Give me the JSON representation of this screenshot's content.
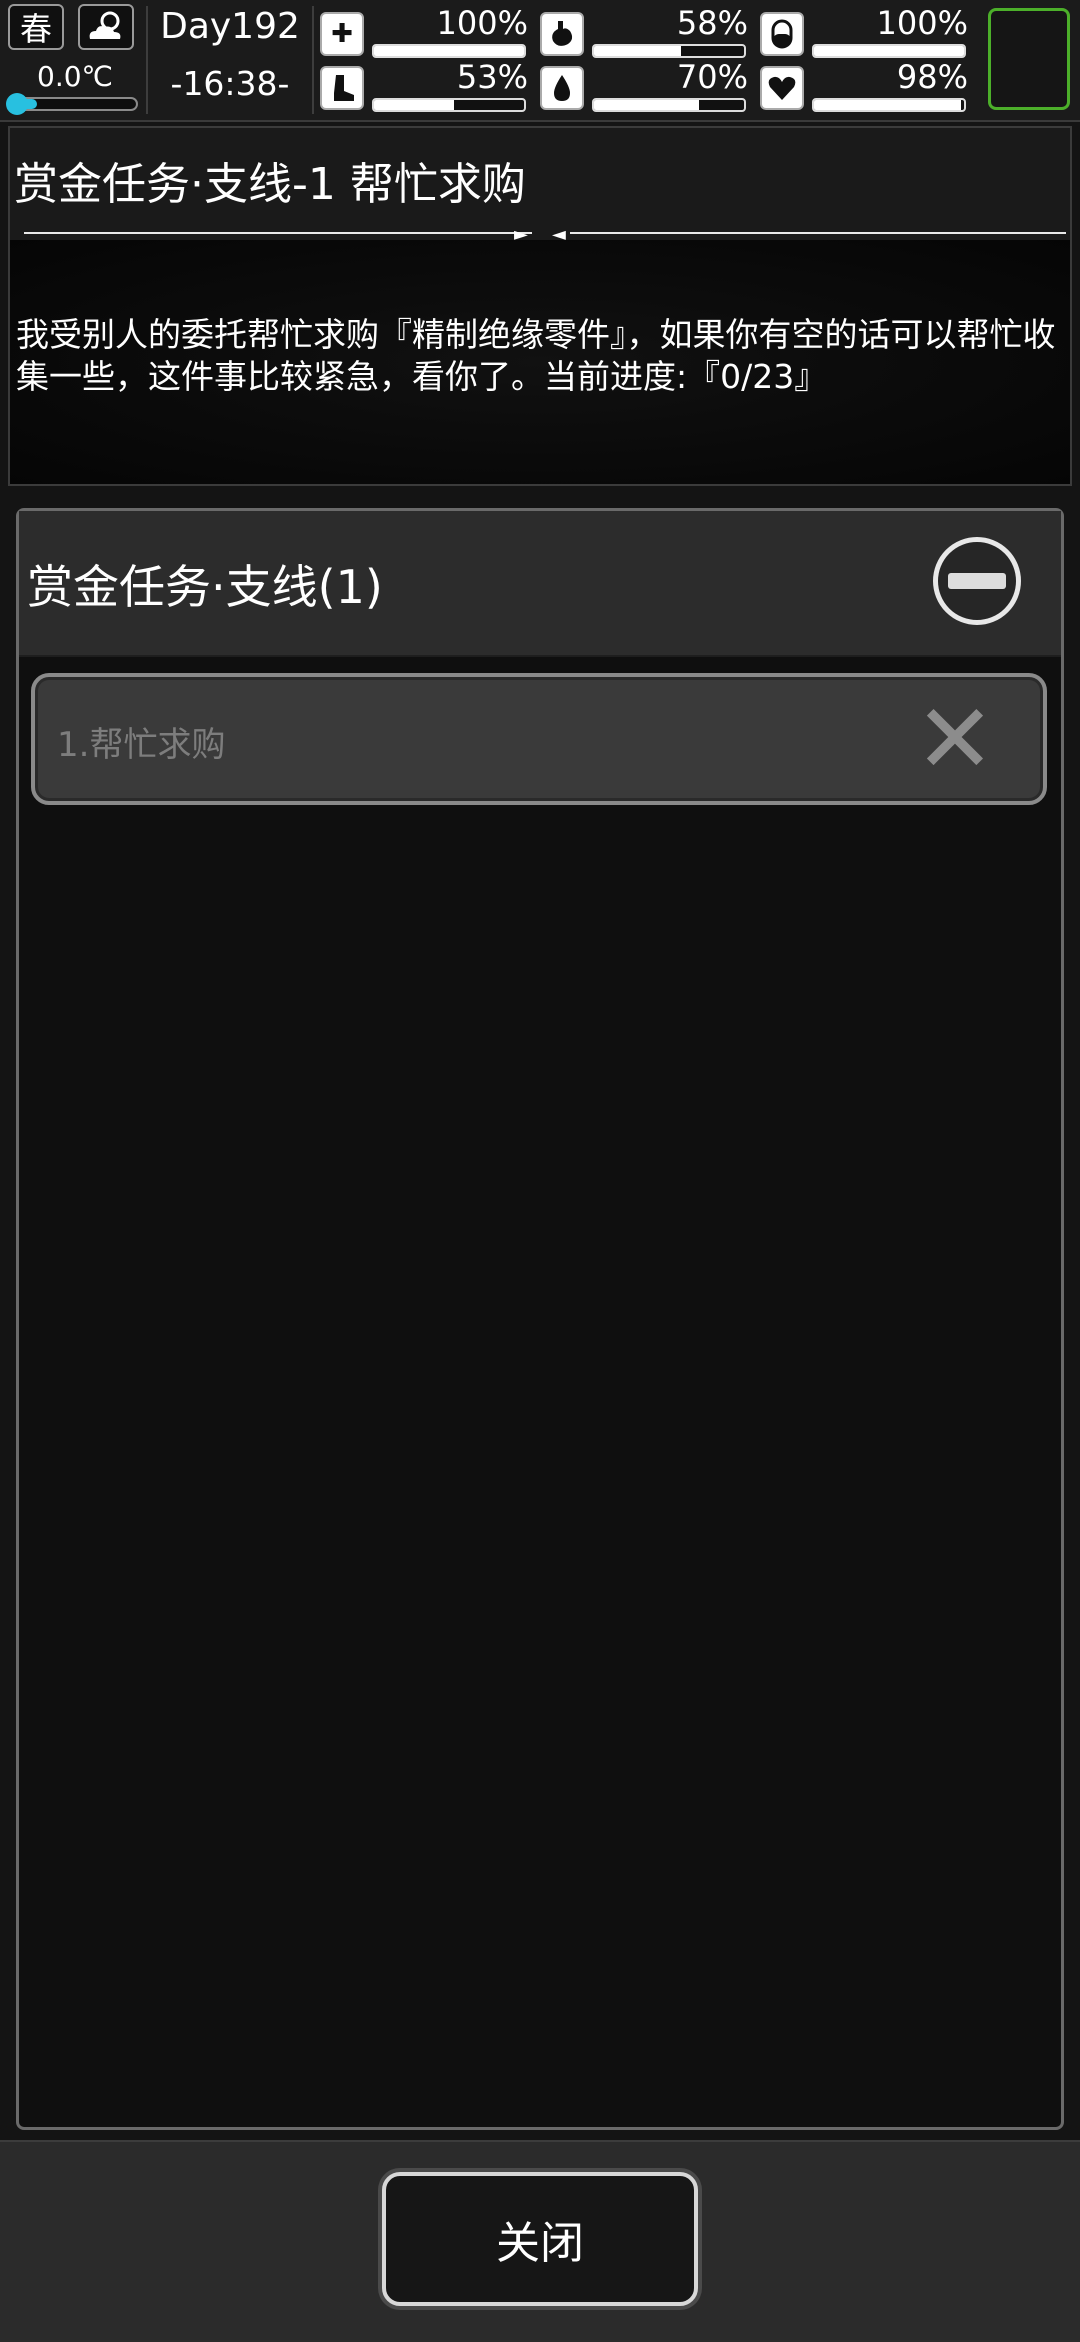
{
  "status_bar": {
    "season": "春",
    "weather_icon": "sun-cloud-icon",
    "temperature": "0.0℃",
    "temperature_level": 0.2,
    "day": "Day192",
    "time": "-16:38-",
    "stats": [
      {
        "icon": "medkit-icon",
        "value": "100%",
        "level": 1.0
      },
      {
        "icon": "stomach-icon",
        "value": "58%",
        "level": 0.58
      },
      {
        "icon": "pill-icon",
        "value": "100%",
        "level": 1.0
      },
      {
        "icon": "foot-icon",
        "value": "53%",
        "level": 0.53
      },
      {
        "icon": "water-drop-icon",
        "value": "70%",
        "level": 0.7
      },
      {
        "icon": "heart-icon",
        "value": "98%",
        "level": 0.98
      }
    ],
    "accent_color": "#4caf2a"
  },
  "detail": {
    "title": "赏金任务·支线-1 帮忙求购",
    "description": "我受别人的委托帮忙求购『精制绝缘零件』，如果你有空的话可以帮忙收集一些，这件事比较紧急，看你了。当前进度:『0/23』"
  },
  "quest_list": {
    "category_title": "赏金任务·支线(1)",
    "items": [
      {
        "label": "1.帮忙求购"
      }
    ]
  },
  "footer": {
    "close_label": "关闭"
  }
}
